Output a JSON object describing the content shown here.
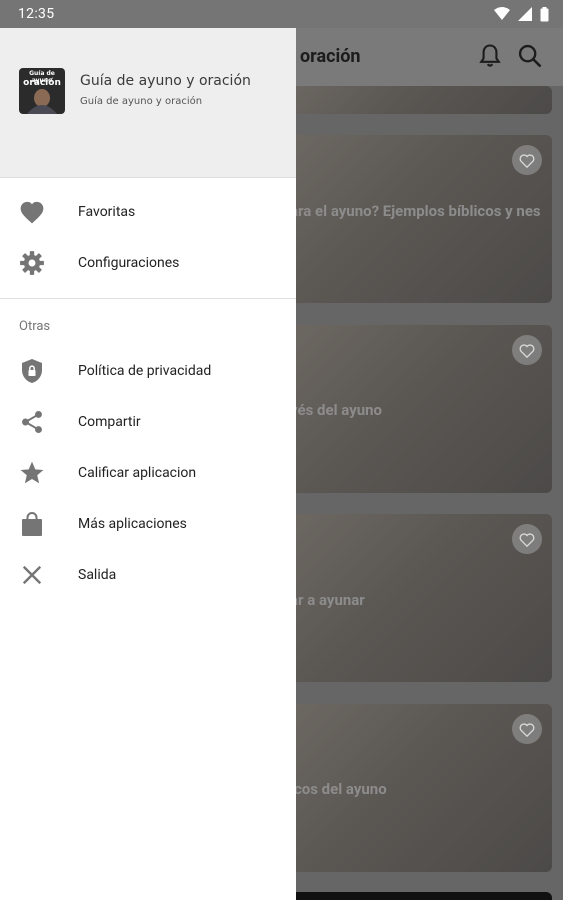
{
  "status_bar": {
    "time": "12:35"
  },
  "app_bar": {
    "title_visible": "oración"
  },
  "cards": [
    {
      "title": ""
    },
    {
      "title": "ara el ayuno? Ejemplos bíblicos y nes"
    },
    {
      "title": "vés del ayuno"
    },
    {
      "title": "ar a ayunar"
    },
    {
      "title": "icos del ayuno"
    }
  ],
  "drawer": {
    "header": {
      "title": "Guía de ayuno y oración",
      "subtitle": "Guía de ayuno y oración",
      "logo_text_top": "Guía de ayuno",
      "logo_text_bottom": "oración"
    },
    "primary_items": [
      {
        "label": "Favoritas",
        "icon": "heart-icon"
      },
      {
        "label": "Configuraciones",
        "icon": "gear-icon"
      }
    ],
    "section_label": "Otras",
    "other_items": [
      {
        "label": "Política de privacidad",
        "icon": "shield-lock-icon"
      },
      {
        "label": "Compartir",
        "icon": "share-icon"
      },
      {
        "label": "Calificar aplicacion",
        "icon": "star-icon"
      },
      {
        "label": "Más aplicaciones",
        "icon": "shopping-bag-icon"
      },
      {
        "label": "Salida",
        "icon": "close-icon"
      }
    ]
  },
  "colors": {
    "icon_gray": "#757575",
    "drawer_header": "#eeeeee",
    "scrim_background": "#666666"
  }
}
